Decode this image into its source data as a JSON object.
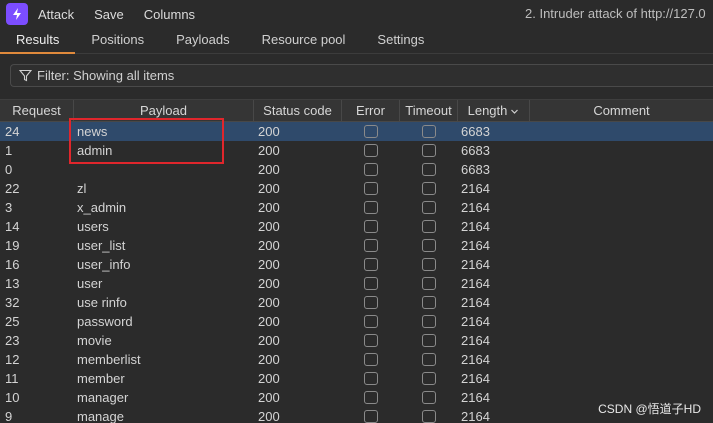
{
  "menu": {
    "items": [
      "Attack",
      "Save",
      "Columns"
    ],
    "window_title": "2. Intruder attack of http://127.0"
  },
  "tabs": {
    "items": [
      "Results",
      "Positions",
      "Payloads",
      "Resource pool",
      "Settings"
    ],
    "active": "Results"
  },
  "filter": {
    "text": "Filter: Showing all items"
  },
  "table": {
    "columns": [
      "Request",
      "Payload",
      "Status code",
      "Error",
      "Timeout",
      "Length",
      "Comment"
    ],
    "sorted_column": "Length",
    "rows": [
      {
        "request": "24",
        "payload": "news",
        "status": "200",
        "length": "6683",
        "selected": true
      },
      {
        "request": "1",
        "payload": "admin",
        "status": "200",
        "length": "6683"
      },
      {
        "request": "0",
        "payload": "",
        "status": "200",
        "length": "6683"
      },
      {
        "request": "22",
        "payload": "zl",
        "status": "200",
        "length": "2164"
      },
      {
        "request": "3",
        "payload": "x_admin",
        "status": "200",
        "length": "2164"
      },
      {
        "request": "14",
        "payload": "users",
        "status": "200",
        "length": "2164"
      },
      {
        "request": "19",
        "payload": "user_list",
        "status": "200",
        "length": "2164"
      },
      {
        "request": "16",
        "payload": "user_info",
        "status": "200",
        "length": "2164"
      },
      {
        "request": "13",
        "payload": "user",
        "status": "200",
        "length": "2164"
      },
      {
        "request": "32",
        "payload": "use rinfo",
        "status": "200",
        "length": "2164"
      },
      {
        "request": "25",
        "payload": "password",
        "status": "200",
        "length": "2164"
      },
      {
        "request": "23",
        "payload": "movie",
        "status": "200",
        "length": "2164"
      },
      {
        "request": "12",
        "payload": "memberlist",
        "status": "200",
        "length": "2164"
      },
      {
        "request": "11",
        "payload": "member",
        "status": "200",
        "length": "2164"
      },
      {
        "request": "10",
        "payload": "manager",
        "status": "200",
        "length": "2164"
      },
      {
        "request": "9",
        "payload": "manage",
        "status": "200",
        "length": "2164"
      }
    ]
  },
  "watermark": "CSDN @悟道子HD",
  "colors": {
    "background": "#2b2b2b",
    "selected_row": "#2f4a6b",
    "active_tab_underline": "#e08a3c",
    "annotation_box": "#e0262c",
    "logo": "#7c4dff"
  }
}
